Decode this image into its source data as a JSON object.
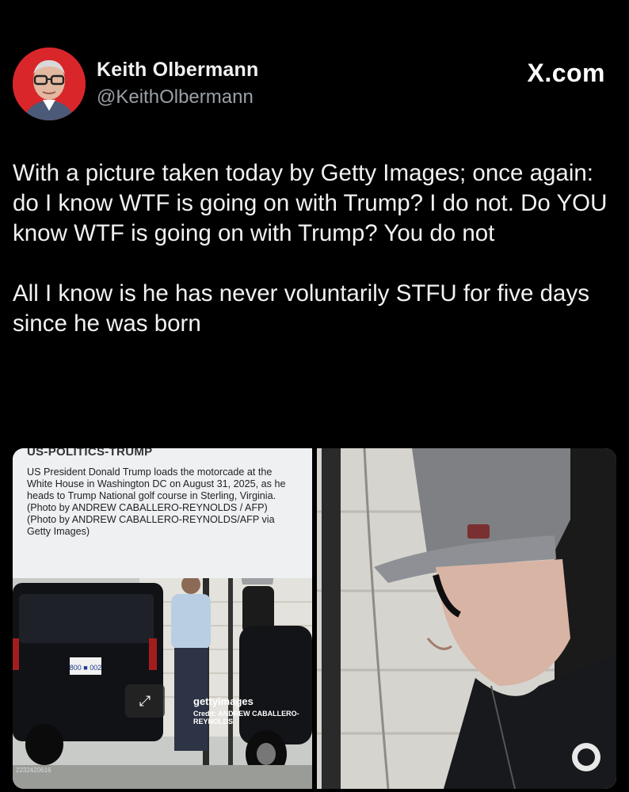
{
  "author": {
    "display_name": "Keith Olbermann",
    "handle": "@KeithOlbermann",
    "avatar_icon": "profile-photo"
  },
  "source_badge": "X.com",
  "tweet": {
    "paragraph_1": "With a picture taken today by Getty Images; once again: do I know WTF is going on with Trump? I do not. Do YOU know WTF is going on with Trump? You do not",
    "paragraph_2": "All I know is he has never voluntarily STFU for five days since he was born"
  },
  "media": {
    "left": {
      "caption_title": "US-POLITICS-TRUMP",
      "caption_body": "US President Donald Trump loads the motorcade at the White House in Washington DC on August 31, 2025, as he heads to Trump National golf course in Sterling, Virginia. (Photo by ANDREW CABALLERO-REYNOLDS / AFP) (Photo by ANDREW CABALLERO-REYNOLDS/AFP via Getty Images)",
      "watermark": "gettyimages",
      "credit": "Credit: ANDREW CABALLERO-REYNOLDS",
      "license_plate": "800 ■ 002",
      "image_id": "2232420616"
    },
    "right": {
      "description_icon": "zoomed-photo"
    }
  },
  "colors": {
    "background": "#000000",
    "text": "#e7e9ea",
    "handle": "#9aa0a6",
    "avatar_bg": "#d9262b"
  }
}
